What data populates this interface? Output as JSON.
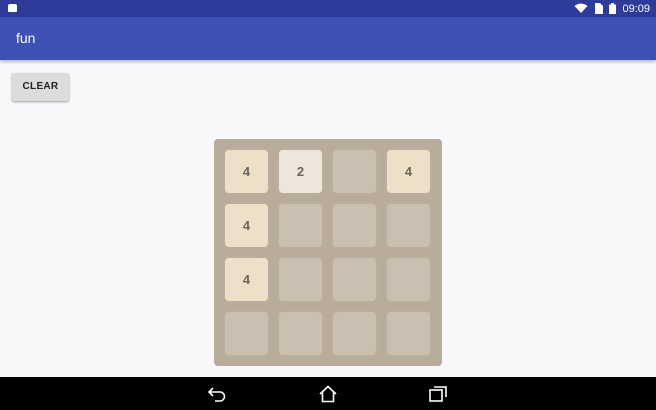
{
  "status_bar": {
    "time": "09:09",
    "icons": [
      "android-icon",
      "wifi-icon",
      "sim-icon",
      "battery-icon"
    ]
  },
  "app_bar": {
    "title": "fun"
  },
  "toolbar": {
    "clear_label": "CLEAR"
  },
  "board": {
    "size": 4,
    "tiles": [
      [
        "4",
        "2",
        "",
        "4"
      ],
      [
        "4",
        "",
        "",
        ""
      ],
      [
        "4",
        "",
        "",
        ""
      ],
      [
        "",
        "",
        "",
        ""
      ]
    ]
  },
  "nav_bar": {
    "icons": [
      "back-icon",
      "home-icon",
      "recents-icon"
    ]
  },
  "colors": {
    "status_bar": "#2e3b9a",
    "app_bar": "#3f51b5",
    "board": "#b9ac9c",
    "tile_empty": "#cbbfb2",
    "tile_2": "#eee6db",
    "tile_4": "#ece1c8",
    "tile_text": "#6d655a"
  }
}
